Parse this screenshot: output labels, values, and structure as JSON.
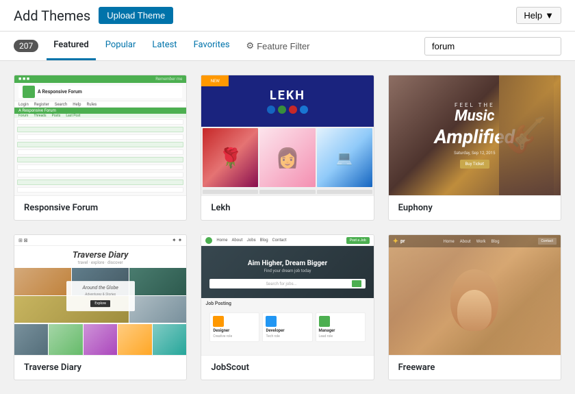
{
  "header": {
    "title": "Add Themes",
    "upload_btn": "Upload Theme",
    "help_btn": "Help",
    "help_arrow": "▼"
  },
  "nav": {
    "count": "207",
    "tabs": [
      {
        "id": "featured",
        "label": "Featured",
        "active": true
      },
      {
        "id": "popular",
        "label": "Popular",
        "active": false
      },
      {
        "id": "latest",
        "label": "Latest",
        "active": false
      },
      {
        "id": "favorites",
        "label": "Favorites",
        "active": false
      }
    ],
    "feature_filter": "Feature Filter",
    "search_placeholder": "forum",
    "search_value": "forum"
  },
  "themes": [
    {
      "id": "responsive-forum",
      "name": "Responsive Forum",
      "type": "responsive-forum"
    },
    {
      "id": "lekh",
      "name": "Lekh",
      "type": "lekh"
    },
    {
      "id": "euphony",
      "name": "Euphony",
      "type": "euphony"
    },
    {
      "id": "traverse-diary",
      "name": "Traverse Diary",
      "type": "traverse"
    },
    {
      "id": "jobscout",
      "name": "JobScout",
      "type": "jobscout"
    },
    {
      "id": "freeware",
      "name": "Freeware",
      "type": "freeware"
    }
  ],
  "icons": {
    "gear": "⚙",
    "chevron_down": "▼",
    "search": "🔍"
  }
}
